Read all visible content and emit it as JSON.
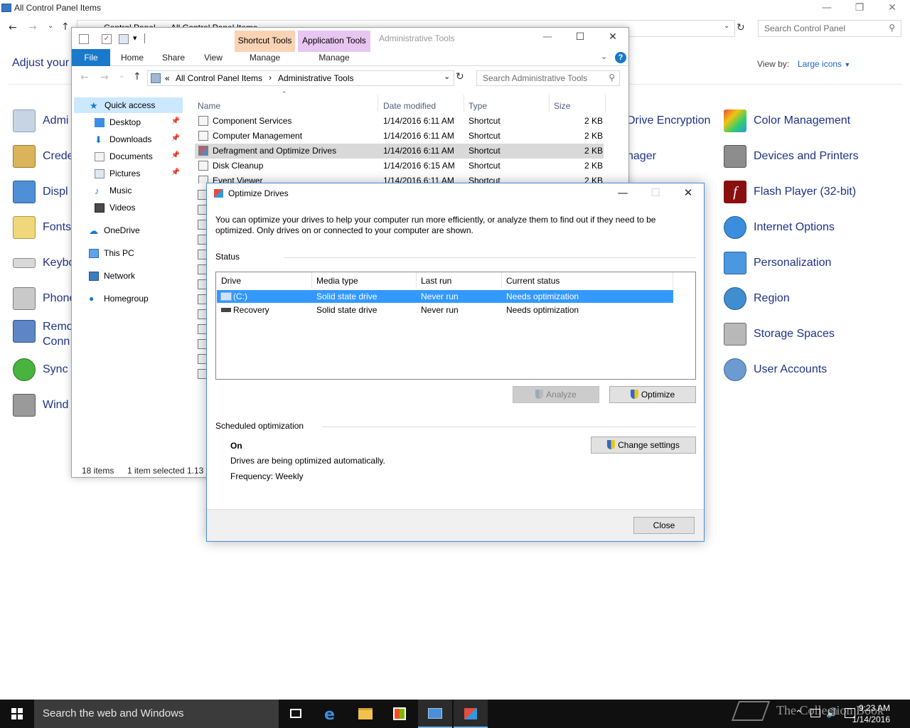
{
  "control_panel": {
    "window_title": "All Control Panel Items",
    "breadcrumb": [
      "Control Panel",
      "All Control Panel Items"
    ],
    "search_placeholder": "Search Control Panel",
    "heading": "Adjust your",
    "view_by_label": "View by:",
    "view_by_value": "Large icons",
    "left_items": [
      "Admi",
      "Crede",
      "Displ",
      "Fonts",
      "Keybo",
      "Phone",
      "Remo",
      "Conn",
      "Sync",
      "Wind"
    ],
    "mid_items": [
      "Drive Encryption",
      "nager"
    ],
    "right_items": [
      "Color Management",
      "Devices and Printers",
      "Flash Player (32-bit)",
      "Internet Options",
      "Personalization",
      "Region",
      "Storage Spaces",
      "User Accounts"
    ]
  },
  "explorer": {
    "title": "Administrative Tools",
    "context_tabs": [
      "Shortcut Tools",
      "Application Tools"
    ],
    "ribbon_tabs": [
      "File",
      "Home",
      "Share",
      "View",
      "Manage",
      "Manage"
    ],
    "address": {
      "prefix": "«",
      "parts": [
        "All Control Panel Items",
        "Administrative Tools"
      ]
    },
    "search_placeholder": "Search Administrative Tools",
    "nav": {
      "quick_access": "Quick access",
      "items": [
        "Desktop",
        "Downloads",
        "Documents",
        "Pictures",
        "Music",
        "Videos"
      ],
      "onedrive": "OneDrive",
      "this_pc": "This PC",
      "network": "Network",
      "homegroup": "Homegroup"
    },
    "columns": [
      "Name",
      "Date modified",
      "Type",
      "Size"
    ],
    "files": [
      {
        "name": "Component Services",
        "date": "1/14/2016 6:11 AM",
        "type": "Shortcut",
        "size": "2 KB"
      },
      {
        "name": "Computer Management",
        "date": "1/14/2016 6:11 AM",
        "type": "Shortcut",
        "size": "2 KB"
      },
      {
        "name": "Defragment and Optimize Drives",
        "date": "1/14/2016 6:11 AM",
        "type": "Shortcut",
        "size": "2 KB"
      },
      {
        "name": "Disk Cleanup",
        "date": "1/14/2016 6:15 AM",
        "type": "Shortcut",
        "size": "2 KB"
      },
      {
        "name": "Event Viewer",
        "date": "1/14/2016 6:11 AM",
        "type": "Shortcut",
        "size": "2 KB"
      }
    ],
    "status": {
      "items": "18 items",
      "selected": "1 item selected",
      "size": "1.13"
    }
  },
  "dialog": {
    "title": "Optimize Drives",
    "intro": "You can optimize your drives to help your computer run more efficiently, or analyze them to find out if they need to be optimized. Only drives on or connected to your computer are shown.",
    "status_label": "Status",
    "columns": [
      "Drive",
      "Media type",
      "Last run",
      "Current status"
    ],
    "drives": [
      {
        "drive": "(C:)",
        "media": "Solid state drive",
        "last_run": "Never run",
        "status": "Needs optimization"
      },
      {
        "drive": "Recovery",
        "media": "Solid state drive",
        "last_run": "Never run",
        "status": "Needs optimization"
      }
    ],
    "analyze_label": "Analyze",
    "optimize_label": "Optimize",
    "scheduled_label": "Scheduled optimization",
    "sched_state": "On",
    "sched_desc": "Drives are being optimized automatically.",
    "sched_freq": "Frequency: Weekly",
    "change_settings_label": "Change settings",
    "close_label": "Close"
  },
  "taskbar": {
    "search_placeholder": "Search the web and Windows",
    "time": "9:23 AM",
    "date": "1/14/2016",
    "watermark": "The Collection Book"
  },
  "colors": {
    "accent": "#1979ca",
    "selection": "#3399ff",
    "link": "#1e3287",
    "shortcut_tools": "#fbd3b4",
    "application_tools": "#e7c6f1"
  }
}
